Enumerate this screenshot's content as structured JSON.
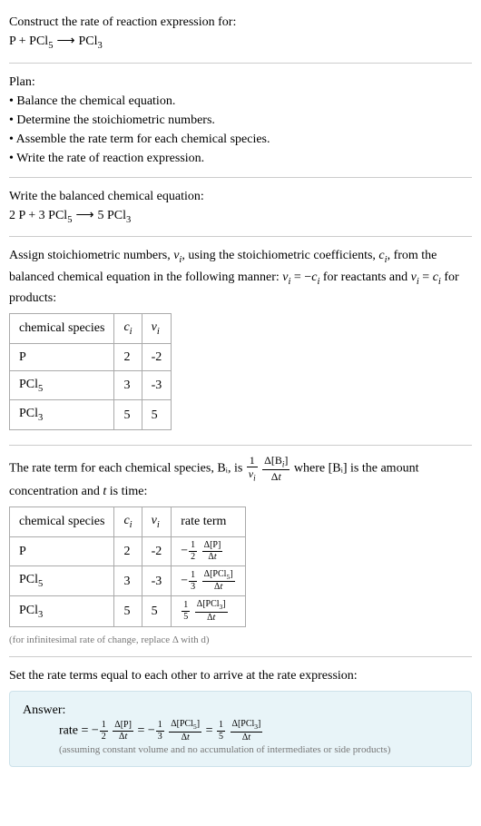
{
  "intro": {
    "prompt": "Construct the rate of reaction expression for:",
    "equation": "P + PCl₅ ⟶ PCl₃"
  },
  "plan": {
    "title": "Plan:",
    "items": [
      "• Balance the chemical equation.",
      "• Determine the stoichiometric numbers.",
      "• Assemble the rate term for each chemical species.",
      "• Write the rate of reaction expression."
    ]
  },
  "balanced": {
    "title": "Write the balanced chemical equation:",
    "equation": "2 P + 3 PCl₅ ⟶ 5 PCl₃"
  },
  "stoich": {
    "intro_before_nu": "Assign stoichiometric numbers, ",
    "nu_i": "νᵢ",
    "intro_mid": ", using the stoichiometric coefficients, ",
    "c_i": "cᵢ",
    "intro_after": ", from the balanced chemical equation in the following manner: νᵢ = −cᵢ for reactants and νᵢ = cᵢ for products:",
    "headers": [
      "chemical species",
      "cᵢ",
      "νᵢ"
    ],
    "rows": [
      {
        "species": "P",
        "c": "2",
        "nu": "-2"
      },
      {
        "species": "PCl₅",
        "c": "3",
        "nu": "-3"
      },
      {
        "species": "PCl₃",
        "c": "5",
        "nu": "5"
      }
    ]
  },
  "rate_term": {
    "intro_a": "The rate term for each chemical species, Bᵢ, is ",
    "intro_b": " where [Bᵢ] is the amount concentration and ",
    "t": "t",
    "intro_c": " is time:",
    "headers": [
      "chemical species",
      "cᵢ",
      "νᵢ",
      "rate term"
    ],
    "rows": [
      {
        "species": "P",
        "c": "2",
        "nu": "-2",
        "coef_num": "1",
        "coef_den": "2",
        "dnum": "Δ[P]",
        "dden": "Δt",
        "neg": true
      },
      {
        "species": "PCl₅",
        "c": "3",
        "nu": "-3",
        "coef_num": "1",
        "coef_den": "3",
        "dnum": "Δ[PCl₅]",
        "dden": "Δt",
        "neg": true
      },
      {
        "species": "PCl₃",
        "c": "5",
        "nu": "5",
        "coef_num": "1",
        "coef_den": "5",
        "dnum": "Δ[PCl₃]",
        "dden": "Δt",
        "neg": false
      }
    ],
    "note": "(for infinitesimal rate of change, replace Δ with d)"
  },
  "final": {
    "title": "Set the rate terms equal to each other to arrive at the rate expression:",
    "answer_label": "Answer:",
    "rate_label": "rate = ",
    "note": "(assuming constant volume and no accumulation of intermediates or side products)"
  }
}
